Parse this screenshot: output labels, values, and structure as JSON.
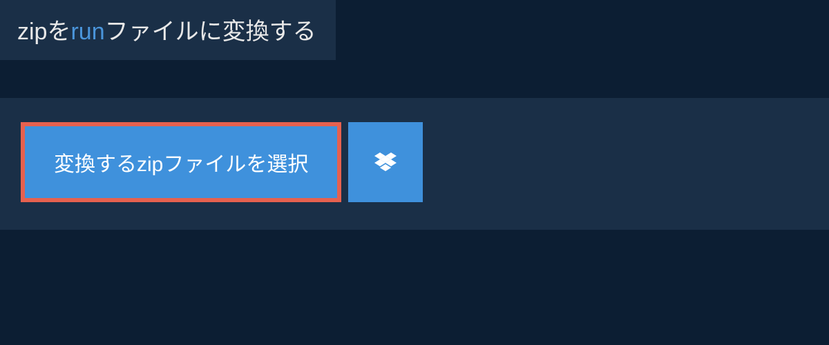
{
  "title": {
    "source_format": "zip",
    "text_1": "を",
    "target_format": "run",
    "text_2": "ファイルに変換する"
  },
  "buttons": {
    "select_file_label": "変換するzipファイルを選択"
  }
}
